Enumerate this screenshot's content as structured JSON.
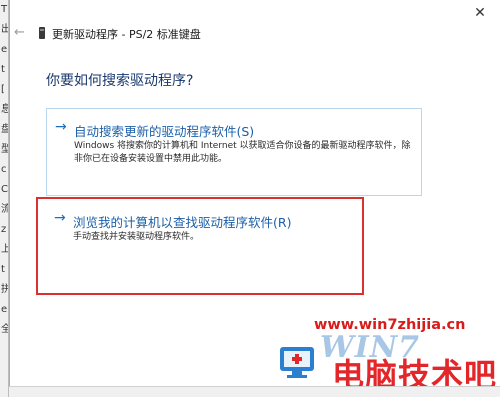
{
  "left_strip": {
    "chars": [
      "T",
      "出",
      "e",
      "t",
      "[",
      "息",
      "盘",
      "型",
      "c",
      "C",
      "流",
      "z",
      "上",
      "t",
      "拼",
      "e",
      "全"
    ]
  },
  "window": {
    "title": "更新驱动程序 - PS/2 标准键盘",
    "back_icon": "back-arrow-icon",
    "close_label": "✕"
  },
  "main": {
    "heading": "你要如何搜索驱动程序?",
    "options": [
      {
        "title": "自动搜索更新的驱动程序软件(S)",
        "description": "Windows 将搜索你的计算机和 Internet 以获取适合你设备的最新驱动程序软件，除非你已在设备安装设置中禁用此功能。"
      },
      {
        "title": "浏览我的计算机以查找驱动程序软件(R)",
        "description": "手动查找并安装驱动程序软件。"
      }
    ]
  },
  "watermark": {
    "url": "www.win7zhijia.cn",
    "win_text": "WIN7",
    "brand_text": "电脑技术吧"
  },
  "colors": {
    "accent": "#1c6fc0",
    "highlight_border": "#d93030",
    "watermark_red": "#d81b1b"
  }
}
